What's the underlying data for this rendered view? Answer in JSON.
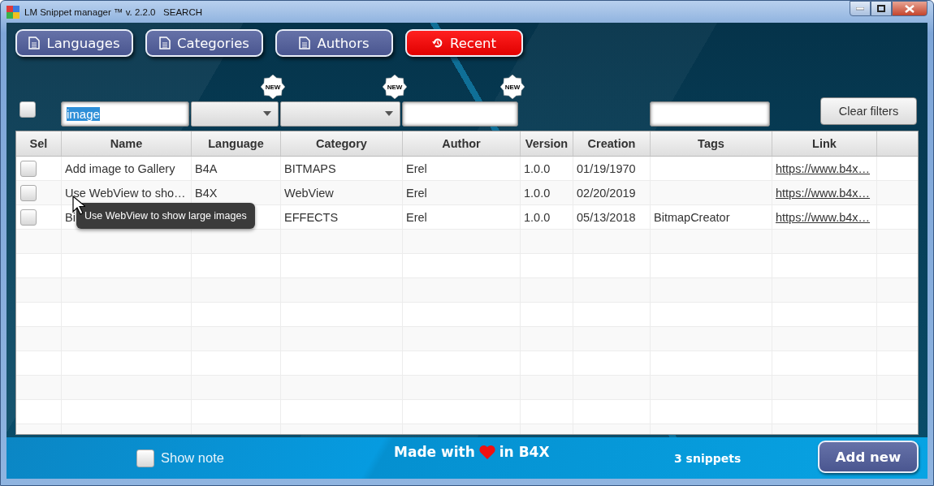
{
  "window": {
    "title": "LM Snippet manager ™ v. 2.2.0   SEARCH"
  },
  "nav_buttons": [
    {
      "label": "Languages",
      "kind": "document"
    },
    {
      "label": "Categories",
      "kind": "document"
    },
    {
      "label": "Authors",
      "kind": "document"
    },
    {
      "label": "Recent",
      "kind": "recent"
    }
  ],
  "filters": [
    {
      "kind": "checkbox",
      "checked": false
    },
    {
      "kind": "text",
      "value": "image",
      "text_selected": true
    },
    {
      "kind": "combo",
      "badge": "NEW"
    },
    {
      "kind": "combo",
      "badge": "NEW"
    },
    {
      "kind": "text",
      "badge": "NEW"
    },
    {
      "kind": "text"
    }
  ],
  "clear_button": "Clear filters",
  "table": {
    "columns": [
      "Sel",
      "Name",
      "Language",
      "Category",
      "Author",
      "Version",
      "Creation",
      "Tags",
      "Link"
    ],
    "rows": [
      {
        "cells": [
          {
            "checked": false
          },
          "Add image to Gallery",
          "B4A",
          "BITMAPS",
          "Erel",
          "1.0.0",
          "01/19/1970",
          "",
          "https://www.b4x…"
        ]
      },
      {
        "cells": [
          {
            "checked": false
          },
          "Use WebView to sho…",
          "B4X",
          "WebView",
          "Erel",
          "1.0.0",
          "02/20/2019",
          "",
          "https://www.b4x…"
        ]
      },
      {
        "cells": [
          {
            "checked": false
          },
          "Bi",
          "",
          "EFFECTS",
          "Erel",
          "1.0.0",
          "05/13/2018",
          "BitmapCreator",
          "https://www.b4x…"
        ]
      }
    ],
    "tooltip": "Use WebView to show large images"
  },
  "footer": {
    "show_note": {
      "label": "Show note",
      "checked": false
    },
    "made_with": {
      "before": "Made with",
      "after": "in B4X"
    },
    "count": "3 snippets",
    "add_button": "Add new"
  }
}
